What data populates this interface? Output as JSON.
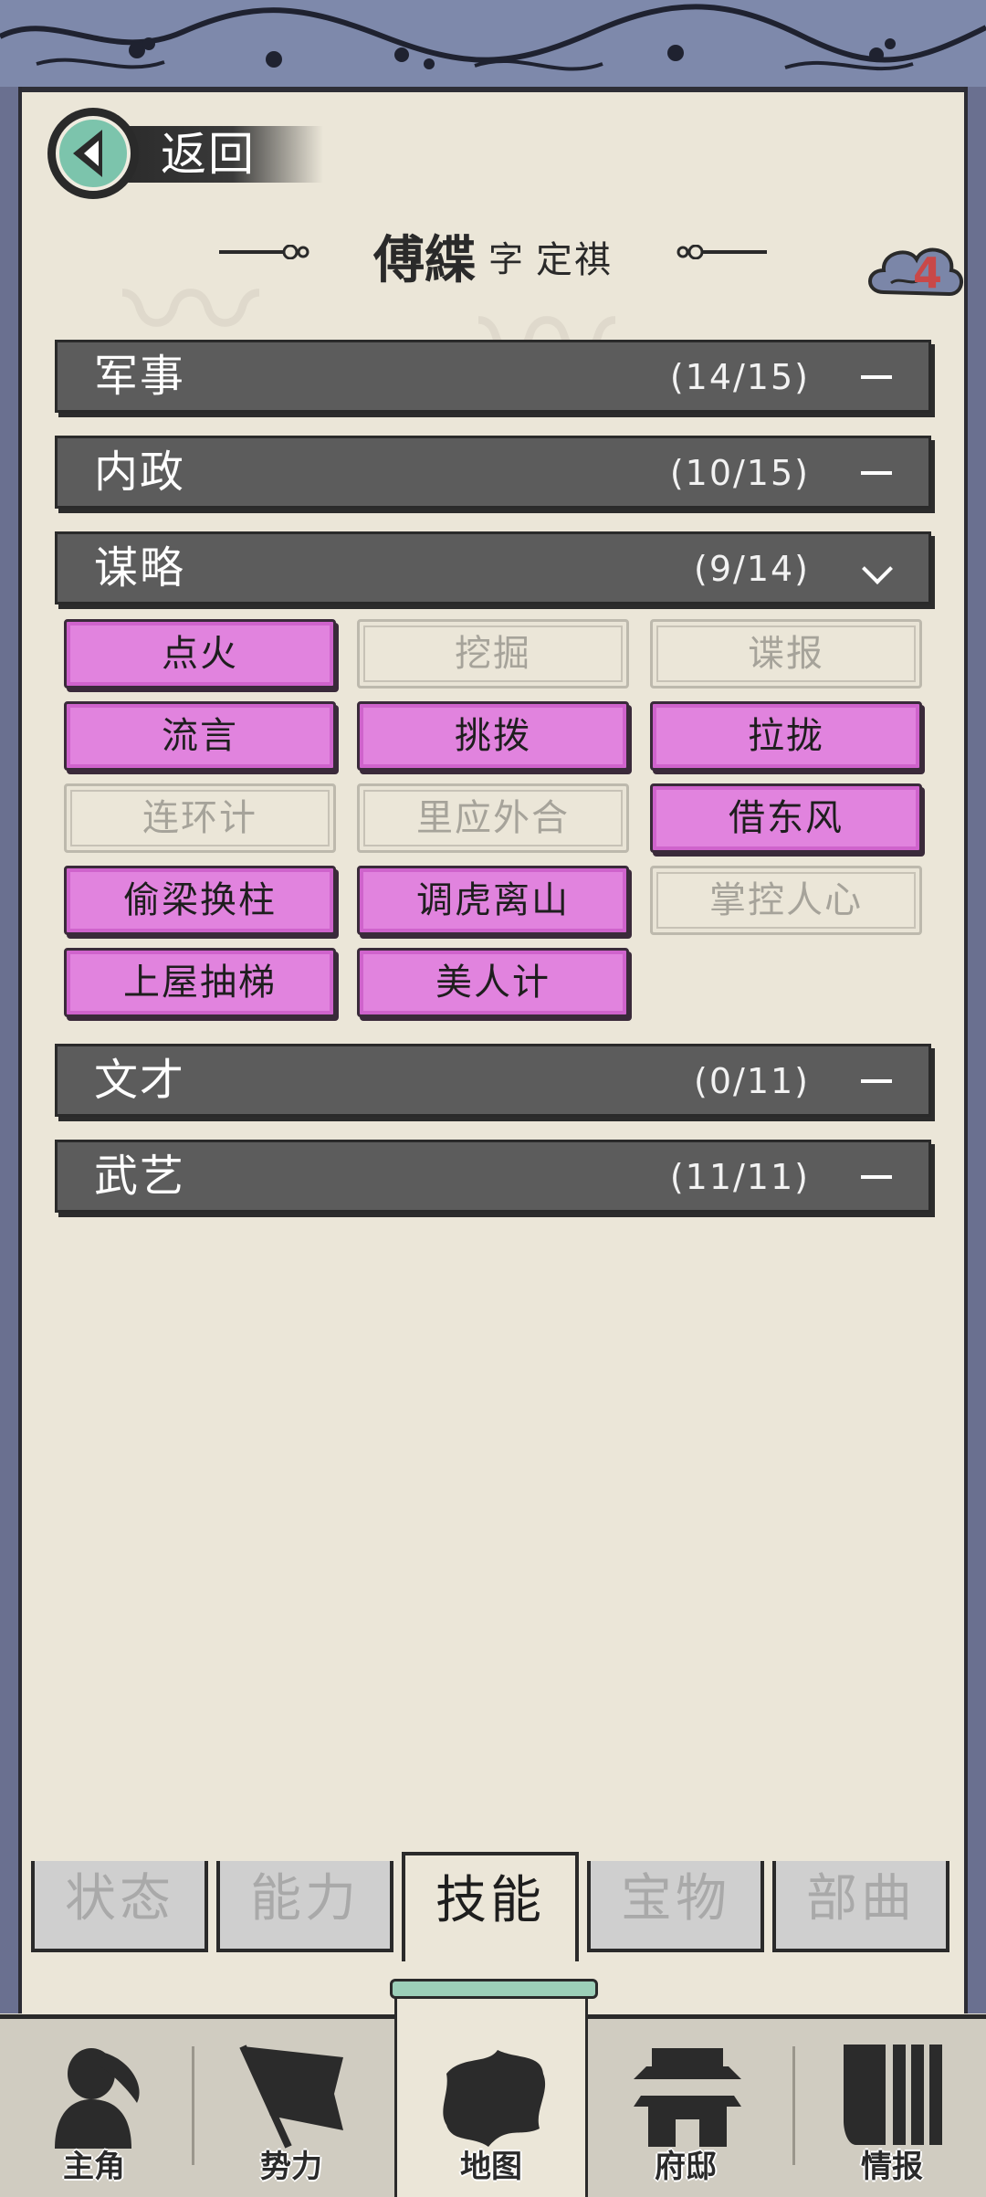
{
  "header": {
    "back_label": "返回",
    "char_name": "傅緤",
    "zi_label": "字",
    "courtesy_name": "定祺",
    "badge_count": "4"
  },
  "categories": [
    {
      "title": "军事",
      "count": "(14/15)",
      "expanded": false
    },
    {
      "title": "内政",
      "count": "(10/15)",
      "expanded": false
    },
    {
      "title": "谋略",
      "count": "(9/14)",
      "expanded": true
    },
    {
      "title": "文才",
      "count": "(0/11)",
      "expanded": false
    },
    {
      "title": "武艺",
      "count": "(11/11)",
      "expanded": false
    }
  ],
  "skills": [
    {
      "label": "点火",
      "learned": true
    },
    {
      "label": "挖掘",
      "learned": false
    },
    {
      "label": "谍报",
      "learned": false
    },
    {
      "label": "流言",
      "learned": true
    },
    {
      "label": "挑拨",
      "learned": true
    },
    {
      "label": "拉拢",
      "learned": true
    },
    {
      "label": "连环计",
      "learned": false
    },
    {
      "label": "里应外合",
      "learned": false
    },
    {
      "label": "借东风",
      "learned": true
    },
    {
      "label": "偷梁换柱",
      "learned": true
    },
    {
      "label": "调虎离山",
      "learned": true
    },
    {
      "label": "掌控人心",
      "learned": false
    },
    {
      "label": "上屋抽梯",
      "learned": true
    },
    {
      "label": "美人计",
      "learned": true
    }
  ],
  "tabs": [
    {
      "label": "状态",
      "active": false
    },
    {
      "label": "能力",
      "active": false
    },
    {
      "label": "技能",
      "active": true
    },
    {
      "label": "宝物",
      "active": false
    },
    {
      "label": "部曲",
      "active": false
    }
  ],
  "bottom_nav": [
    {
      "label": "主角",
      "icon": "warrior-icon"
    },
    {
      "label": "势力",
      "icon": "banner-flag-icon"
    },
    {
      "label": "地图",
      "icon": "map-icon",
      "active": true
    },
    {
      "label": "府邸",
      "icon": "mansion-icon"
    },
    {
      "label": "情报",
      "icon": "scroll-icon"
    }
  ],
  "colors": {
    "learned_skill": "#e183de",
    "category_bar": "#5c5c5c",
    "paper": "#ebe6d8",
    "frame": "#7e89ab",
    "badge_text": "#c94848"
  }
}
